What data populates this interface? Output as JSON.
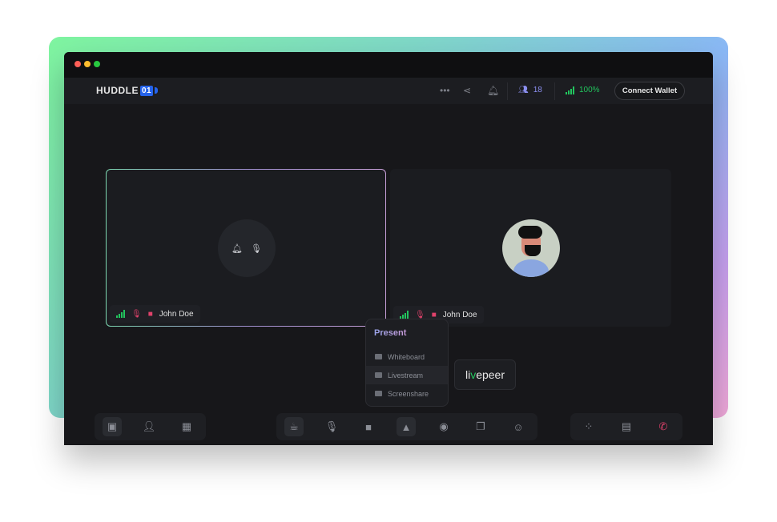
{
  "window": {
    "traffic_lights": [
      "#ff5f57",
      "#febc2e",
      "#28c840"
    ]
  },
  "header": {
    "logo_text": "HUDDLE",
    "logo_num": "01",
    "peer_count": "18",
    "signal": "100%",
    "connect_wallet": "Connect Wallet",
    "more_icon": "more-dots",
    "share_icon": "share",
    "bell_icon": "bell"
  },
  "tiles": [
    {
      "name": "John Doe",
      "active": true,
      "mic": "muted",
      "video": "off"
    },
    {
      "name": "John Doe",
      "active": false,
      "mic": "muted",
      "video": "off"
    }
  ],
  "present_menu": {
    "title": "Present",
    "items": [
      {
        "label": "Whiteboard"
      },
      {
        "label": "Livestream",
        "highlighted": true
      },
      {
        "label": "Screenshare"
      }
    ]
  },
  "tooltip": {
    "brand_pre": "li",
    "brand_mark": "v",
    "brand_post": "epeer"
  },
  "colors": {
    "accent": "#2563eb",
    "signal": "#22c55e",
    "muted": "#e0426b",
    "peers": "#8b8ff0"
  }
}
